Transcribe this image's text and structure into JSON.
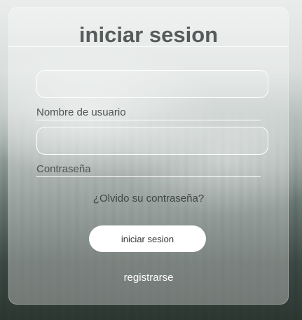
{
  "login": {
    "title": "iniciar sesion",
    "username_label": "Nombre de usuario",
    "username_value": "",
    "password_label": "Contraseña",
    "password_value": "",
    "forgot_link": "¿Olvido su contraseña?",
    "submit_label": "iniciar sesion",
    "register_link": "registrarse"
  }
}
